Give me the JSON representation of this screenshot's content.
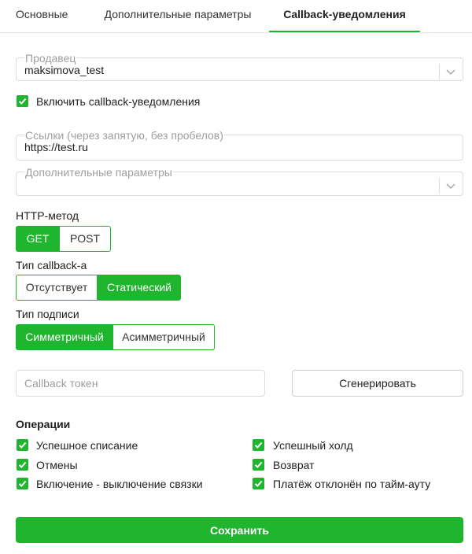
{
  "tabs": [
    {
      "label": "Основные"
    },
    {
      "label": "Дополнительные параметры"
    },
    {
      "label": "Callback-уведомления"
    }
  ],
  "seller": {
    "label": "Продавец",
    "value": "maksimova_test"
  },
  "enable_callback": {
    "label": "Включить callback-уведомления",
    "checked": true
  },
  "links": {
    "label": "Ссылки (через запятую, без пробелов)",
    "value": "https://test.ru"
  },
  "extra_params": {
    "label": "Дополнительные параметры",
    "value": ""
  },
  "http_method": {
    "label": "HTTP-метод",
    "options": [
      "GET",
      "POST"
    ],
    "selected": "GET"
  },
  "callback_type": {
    "label": "Тип callback-а",
    "options": [
      "Отсутствует",
      "Статический"
    ],
    "selected": "Статический"
  },
  "signature_type": {
    "label": "Тип подписи",
    "options": [
      "Симметричный",
      "Асимметричный"
    ],
    "selected": "Симметричный"
  },
  "token": {
    "placeholder": "Callback токен",
    "value": ""
  },
  "generate_label": "Сгенерировать",
  "operations": {
    "title": "Операции",
    "items": [
      {
        "label": "Успешное списание",
        "checked": true
      },
      {
        "label": "Успешный холд",
        "checked": true
      },
      {
        "label": "Отмены",
        "checked": true
      },
      {
        "label": "Возврат",
        "checked": true
      },
      {
        "label": "Включение - выключение связки",
        "checked": true
      },
      {
        "label": "Платёж отклонён по тайм-ауту",
        "checked": true
      }
    ]
  },
  "save_label": "Сохранить",
  "colors": {
    "accent": "#1fb52e",
    "border": "#dcdcdc",
    "placeholder": "#9e9e9e"
  },
  "icons": {
    "checkbox": "check-icon",
    "select": "chevron-down-icon"
  }
}
